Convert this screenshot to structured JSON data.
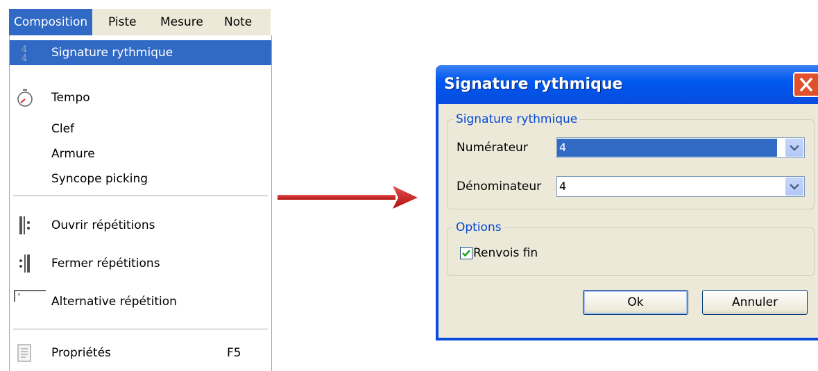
{
  "menubar": {
    "items": [
      "Composition",
      "Piste",
      "Mesure",
      "Note"
    ]
  },
  "dropdown": {
    "items": [
      {
        "label": "Signature rythmique",
        "icon": "time-signature-icon"
      },
      {
        "label": "Tempo",
        "icon": "stopwatch-icon"
      },
      {
        "label": "Clef"
      },
      {
        "label": "Armure"
      },
      {
        "label": "Syncope picking"
      },
      {
        "label": "Ouvrir répétitions",
        "icon": "repeat-open-icon"
      },
      {
        "label": "Fermer répétitions",
        "icon": "repeat-close-icon"
      },
      {
        "label": "Alternative répétition",
        "icon": "alternative-ending-icon"
      },
      {
        "label": "Propriétés",
        "icon": "properties-icon",
        "shortcut": "F5"
      }
    ]
  },
  "dialog": {
    "title": "Signature rythmique",
    "group1_legend": "Signature rythmique",
    "numerator_label": "Numérateur",
    "numerator_value": "4",
    "denominator_label": "Dénominateur",
    "denominator_value": "4",
    "group2_legend": "Options",
    "checkbox_label": "Renvois fin",
    "checkbox_checked": true,
    "ok_label": "Ok",
    "cancel_label": "Annuler"
  },
  "colors": {
    "selection": "#316ac5",
    "arrow": "#cc1f1f",
    "titlebar": "#0a4be0",
    "legend_text": "#0046d5"
  }
}
